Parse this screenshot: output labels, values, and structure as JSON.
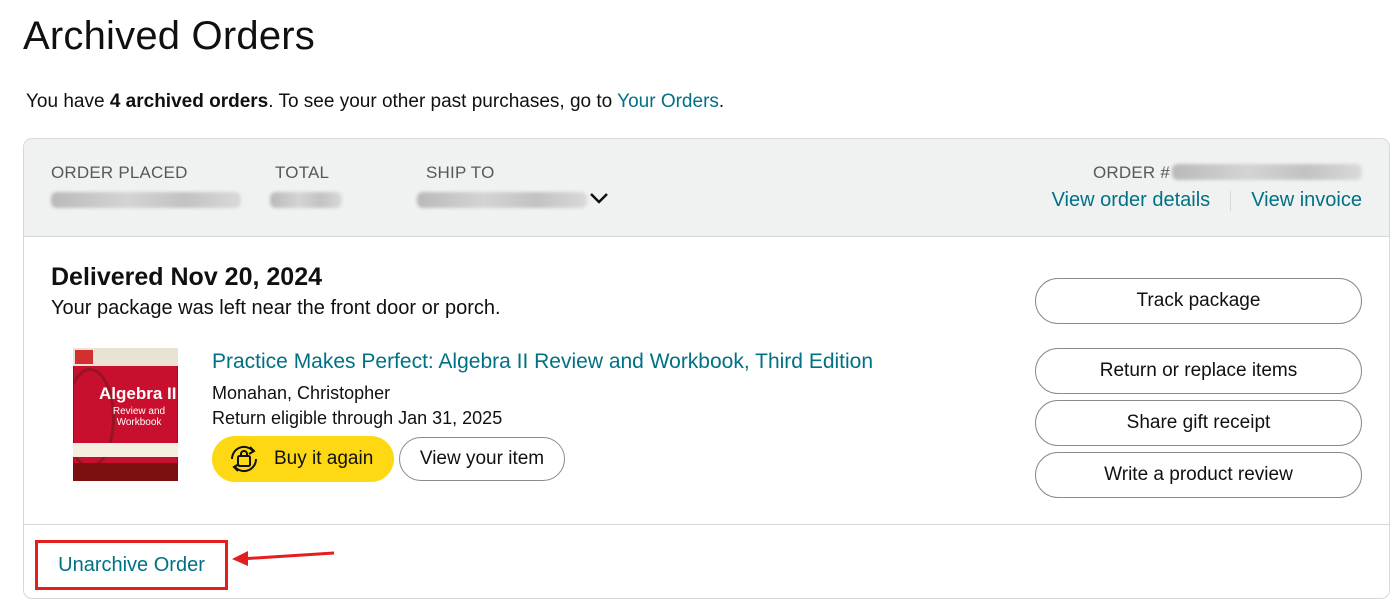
{
  "page": {
    "title": "Archived Orders",
    "summary_prefix": "You have ",
    "summary_count": "4 archived orders",
    "summary_mid": ". To see your other past purchases, go to ",
    "summary_link": "Your Orders",
    "summary_end": "."
  },
  "order": {
    "header": {
      "order_placed_label": "ORDER PLACED",
      "total_label": "TOTAL",
      "ship_to_label": "SHIP TO",
      "order_number_label": "ORDER #",
      "view_details": "View order details",
      "view_invoice": "View invoice"
    },
    "status": {
      "headline": "Delivered Nov 20, 2024",
      "note": "Your package was left near the front door or porch."
    },
    "item": {
      "title": "Practice Makes Perfect: Algebra II Review and Workbook, Third Edition",
      "author": "Monahan, Christopher",
      "return_eligibility": "Return eligible through Jan 31, 2025",
      "cover": {
        "title": "Algebra II",
        "subtitle": "Review and Workbook"
      },
      "buy_again": "Buy it again",
      "view_item": "View your item"
    },
    "actions": {
      "track": "Track package",
      "return": "Return or replace items",
      "gift": "Share gift receipt",
      "review": "Write a product review"
    },
    "footer": {
      "unarchive": "Unarchive Order"
    }
  },
  "colors": {
    "link": "#007185",
    "buy_button": "#ffd814",
    "header_bg": "#f0f2f2",
    "annotation": "#e41e1e"
  }
}
